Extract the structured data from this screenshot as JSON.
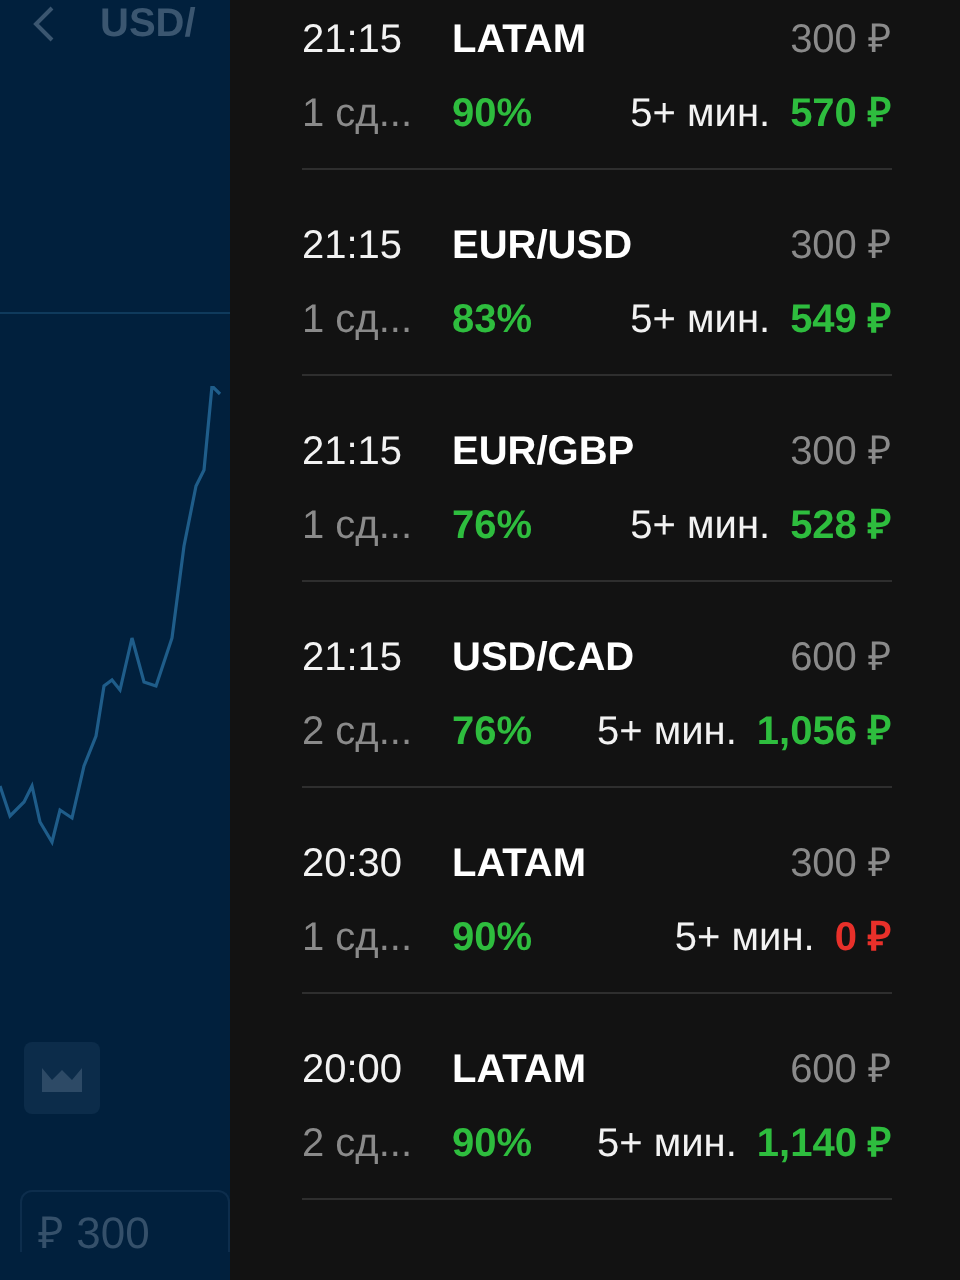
{
  "chart_panel": {
    "pair": "USD/",
    "amount": "₽ 300"
  },
  "trades": [
    {
      "time": "21:15",
      "asset": "LATAM",
      "stake": "300 ₽",
      "count": "1 сд...",
      "percent": "90%",
      "duration": "5+ мин.",
      "payout": "570 ₽",
      "color": "#2ebd3e"
    },
    {
      "time": "21:15",
      "asset": "EUR/USD",
      "stake": "300 ₽",
      "count": "1 сд...",
      "percent": "83%",
      "duration": "5+ мин.",
      "payout": "549 ₽",
      "color": "#2ebd3e"
    },
    {
      "time": "21:15",
      "asset": "EUR/GBP",
      "stake": "300 ₽",
      "count": "1 сд...",
      "percent": "76%",
      "duration": "5+ мин.",
      "payout": "528 ₽",
      "color": "#2ebd3e"
    },
    {
      "time": "21:15",
      "asset": "USD/CAD",
      "stake": "600 ₽",
      "count": "2 сд...",
      "percent": "76%",
      "duration": "5+ мин.",
      "payout": "1,056 ₽",
      "color": "#2ebd3e"
    },
    {
      "time": "20:30",
      "asset": "LATAM",
      "stake": "300 ₽",
      "count": "1 сд...",
      "percent": "90%",
      "duration": "5+ мин.",
      "payout": "0 ₽",
      "color": "#e8302a"
    },
    {
      "time": "20:00",
      "asset": "LATAM",
      "stake": "600 ₽",
      "count": "2 сд...",
      "percent": "90%",
      "duration": "5+ мин.",
      "payout": "1,140 ₽",
      "color": "#2ebd3e"
    }
  ]
}
